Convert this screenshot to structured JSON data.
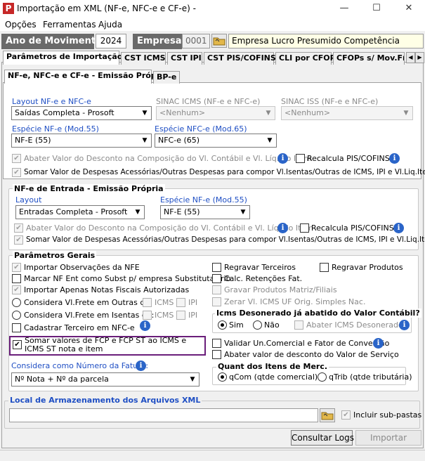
{
  "window": {
    "title": "Importação em XML (NF-e, NFC-e e CF-e) -",
    "minimize": "—",
    "maximize": "☐",
    "close": "✕"
  },
  "menu": [
    "Opções",
    "Ferramentas",
    "Ajuda"
  ],
  "header": {
    "ano_label": "Ano de Movimento",
    "ano_value": "2024",
    "empresa_label": "Empresa",
    "empresa_code": "0001",
    "empresa_name": "Empresa Lucro Presumido Competência"
  },
  "tabs": [
    "Parâmetros de Importação",
    "CST ICMS",
    "CST IPI",
    "CST PIS/COFINS",
    "CLI por CFOP",
    "CFOPs s/ Mov.Fís"
  ],
  "subtabs": [
    "NF-e, NFC-e e CF-e - Emissão Própria",
    "BP-e"
  ],
  "emissao": {
    "layout_label": "Layout NF-e e NFC-e",
    "layout_value": "Saídas Completa - Prosoft",
    "sinac_icms_label": "SINAC ICMS (NF-e e NFC-e)",
    "sinac_icms_value": "<Nenhum>",
    "sinac_iss_label": "SINAC ISS (NF-e e NFC-e)",
    "sinac_iss_value": "<Nenhum>",
    "especie_nfe_label": "Espécie NF-e (Mod.55)",
    "especie_nfe_value": "NF-E (55)",
    "especie_nfce_label": "Espécie NFC-e (Mod.65)",
    "especie_nfce_value": "NFC-e (65)",
    "abater": "Abater Valor do Desconto na Composição do Vl. Contábil e Vl. Líq. do Item",
    "recalcula": "Recalcula PIS/COFINS?",
    "somar": "Somar Valor de Despesas Acessórias/Outras Despesas para compor Vl.Isentas/Outras de ICMS, IPI e Vl.Liq.Item"
  },
  "entrada": {
    "title": "NF-e de Entrada - Emissão Própria",
    "layout_label": "Layout",
    "layout_value": "Entradas Completa - Prosoft",
    "especie_label": "Espécie NF-e (Mod.55)",
    "especie_value": "NF-E (55)",
    "abater": "Abater Valor do Desconto na Composição do Vl. Contábil e Vl. Líq. do Item",
    "recalcula": "Recalcula PIS/COFINS?",
    "somar": "Somar Valor de Despesas Acessórias/Outras Despesas para compor Vl.Isentas/Outras de ICMS, IPI e Vl.Liq.Item"
  },
  "gerais": {
    "title": "Parâmetros Gerais",
    "importar_obs": "Importar Observações da NFE",
    "marcar_nf": "Marcar NF Ent como Subst p/ empresa Substituta Trib",
    "importar_apenas": "Importar Apenas Notas Fiscais Autorizadas",
    "frete_outras": "Considera Vl.Frete em Outras de:",
    "frete_isentas": "Considera Vl.Frete em Isentas de:",
    "icms": "ICMS",
    "ipi": "IPI",
    "cadastrar": "Cadastrar Terceiro em NFC-e",
    "somar_fcp": "Somar valores de FCP e FCP ST ao ICMS e ICMS ST nota e item",
    "regravar_terceiros": "Regravar Terceiros",
    "regravar_produtos": "Regravar Produtos",
    "calc_retencoes": "Calc. Retenções Fat.",
    "gravar_produtos": "Gravar Produtos Matriz/Filiais",
    "zerar_icms": "Zerar Vl. ICMS UF Orig. Simples Nac.",
    "icms_deson_title": "Icms Desonerado já abatido do Valor Contábil?",
    "sim": "Sim",
    "nao": "Não",
    "abater_deson": "Abater ICMS Desonerado",
    "validar": "Validar Un.Comercial e Fator de Conversão",
    "abater_desconto": "Abater valor de desconto do Valor de Serviço",
    "fatura_label": "Considera como Número da Fatura:",
    "fatura_value": "Nº Nota + Nº da parcela",
    "quant_title": "Quant dos Itens de Merc.",
    "qcom": "qCom (qtde comercial)",
    "qtrib": "qTrib (qtde tributária)"
  },
  "local": {
    "title": "Local de Armazenamento dos Arquivos XML",
    "path": "",
    "incluir": "Incluir sub-pastas"
  },
  "buttons": {
    "consultar": "Consultar Logs",
    "importar": "Importar"
  }
}
